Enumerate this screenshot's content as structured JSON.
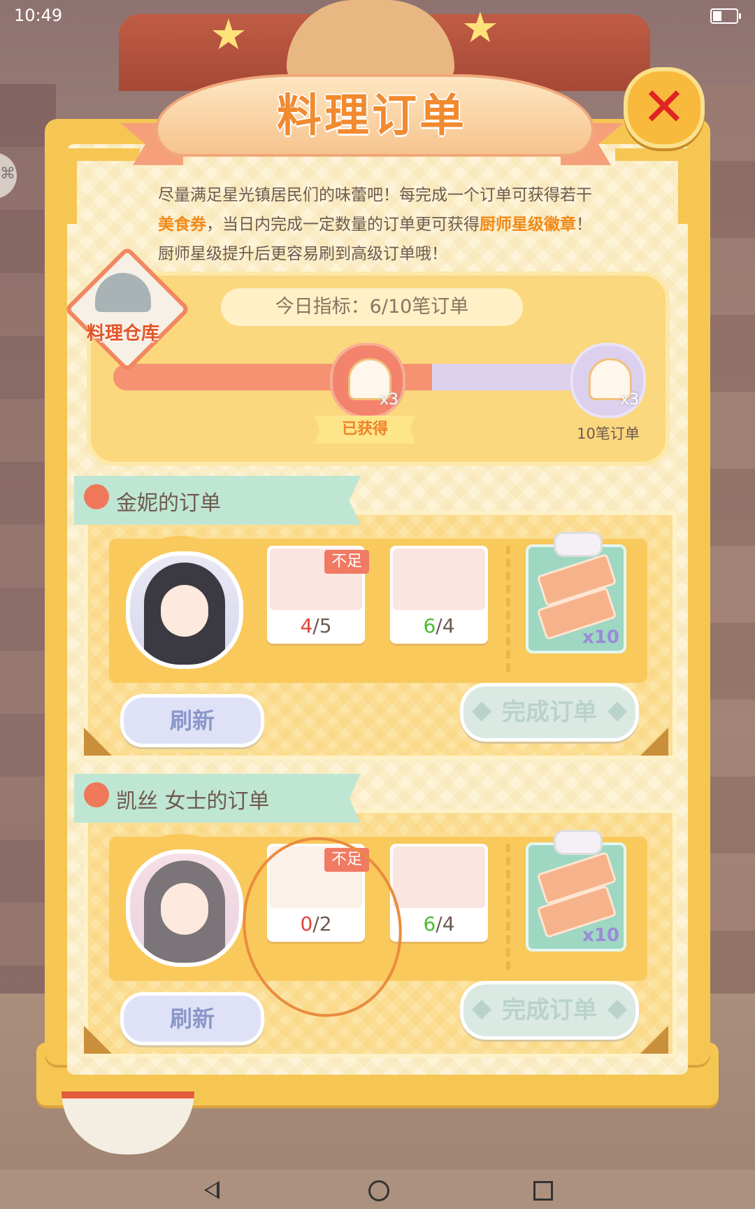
{
  "status": {
    "time": "10:49"
  },
  "side_icon": "link-icon",
  "title": "料理订单",
  "close_icon": "close-icon",
  "intro": {
    "p1": "尽量满足星光镇居民们的味蕾吧！每完成一个订单可获得若干",
    "hl1": "美食券",
    "p2": "，当日内完成一定数量的订单更可获得",
    "hl2": "厨师星级徽章",
    "p3": "！厨师星级提升后更容易刷到高级订单哦！"
  },
  "warehouse": {
    "label": "料理仓库"
  },
  "progress": {
    "goal_text": "今日指标：6/10笔订单",
    "current": 6,
    "total": 10,
    "milestones": [
      {
        "reward_qty": "x3",
        "status": "已获得"
      },
      {
        "reward_qty": "x3",
        "label": "10笔订单"
      }
    ]
  },
  "orders": [
    {
      "customer": "金妮的订单",
      "items": [
        {
          "have": "4",
          "need": "5",
          "shortage": "不足",
          "icon": "shrimp-salad-icon"
        },
        {
          "have": "6",
          "need": "4",
          "icon": "roast-dish-icon"
        }
      ],
      "reward": {
        "qty": "x10",
        "icon": "food-coupon-gift-icon"
      },
      "refresh_label": "刷新",
      "complete_label": "完成订单"
    },
    {
      "customer": "凯丝 女士的订单",
      "items": [
        {
          "have": "0",
          "need": "2",
          "shortage": "不足",
          "icon": "banana-icon"
        },
        {
          "have": "6",
          "need": "4",
          "icon": "roast-dish-icon"
        }
      ],
      "reward": {
        "qty": "x10",
        "icon": "food-coupon-gift-icon"
      },
      "refresh_label": "刷新",
      "complete_label": "完成订单"
    }
  ],
  "colors": {
    "accent": "#f28a2f",
    "panel": "#f6c653",
    "short": "#e0453a",
    "enough": "#4cbb2e"
  },
  "nav": [
    "back-icon",
    "home-icon",
    "recent-apps-icon"
  ]
}
